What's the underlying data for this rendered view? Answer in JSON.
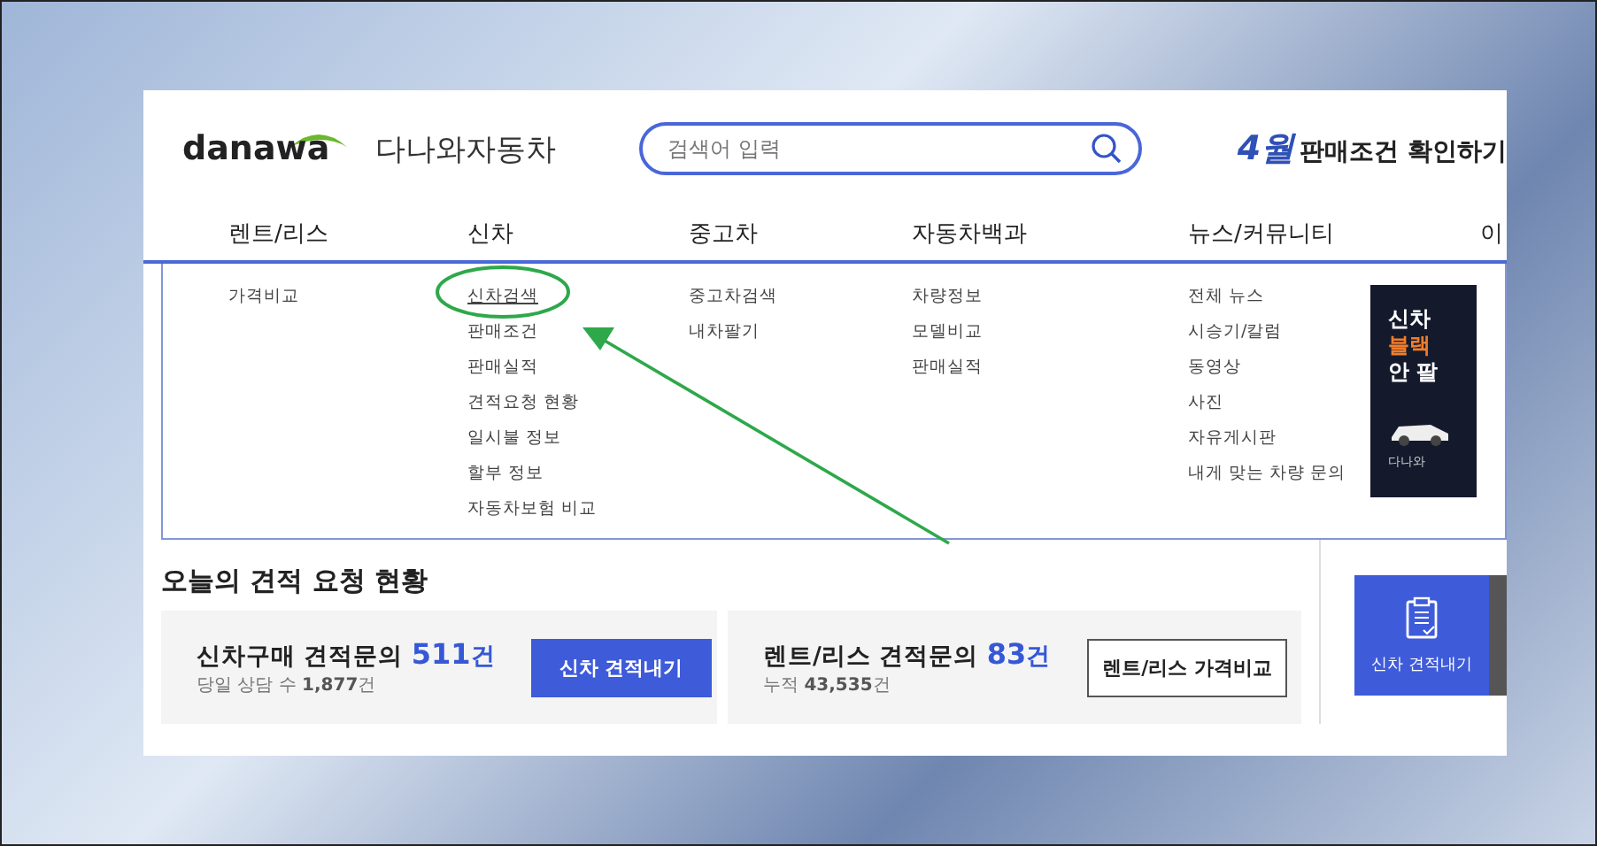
{
  "header": {
    "logo_text": "danawa",
    "brand": "다나와자동차",
    "search": {
      "placeholder": "검색어 입력"
    },
    "promo": {
      "month": "4월",
      "text": "판매조건 확인하기"
    }
  },
  "nav": [
    {
      "label": "렌트/리스",
      "items": [
        {
          "label": "가격비교",
          "selected": false
        }
      ]
    },
    {
      "label": "신차",
      "items": [
        {
          "label": "신차검색",
          "selected": true
        },
        {
          "label": "판매조건",
          "selected": false
        },
        {
          "label": "판매실적",
          "selected": false
        },
        {
          "label": "견적요청 현황",
          "selected": false
        },
        {
          "label": "일시불 정보",
          "selected": false
        },
        {
          "label": "할부 정보",
          "selected": false
        },
        {
          "label": "자동차보험 비교",
          "selected": false
        }
      ]
    },
    {
      "label": "중고차",
      "items": [
        {
          "label": "중고차검색",
          "selected": false
        },
        {
          "label": "내차팔기",
          "selected": false
        }
      ]
    },
    {
      "label": "자동차백과",
      "items": [
        {
          "label": "차량정보",
          "selected": false
        },
        {
          "label": "모델비교",
          "selected": false
        },
        {
          "label": "판매실적",
          "selected": false
        }
      ]
    },
    {
      "label": "뉴스/커뮤니티",
      "items": [
        {
          "label": "전체 뉴스",
          "selected": false
        },
        {
          "label": "시승기/칼럼",
          "selected": false
        },
        {
          "label": "동영상",
          "selected": false
        },
        {
          "label": "사진",
          "selected": false
        },
        {
          "label": "자유게시판",
          "selected": false
        },
        {
          "label": "내게 맞는 차량 문의",
          "selected": false
        }
      ]
    },
    {
      "label": "이"
    }
  ],
  "ad": {
    "lines": [
      "신차",
      "블랙",
      "안 팔"
    ],
    "caption": "다나와"
  },
  "quotes": {
    "title": "오늘의 견적 요청 현황",
    "cards": [
      {
        "label": "신차구매 견적문의",
        "count": "511",
        "unit": "건",
        "sub_label": "당일 상담 수",
        "sub_count": "1,877",
        "sub_unit": "건",
        "button": "신차 견적내기",
        "kind": "primary"
      },
      {
        "label": "렌트/리스 견적문의",
        "count": "83",
        "unit": "건",
        "sub_label": "누적",
        "sub_count": "43,535",
        "sub_unit": "건",
        "button": "렌트/리스 가격비교",
        "kind": "outline"
      }
    ]
  },
  "side_button": {
    "label": "신차 견적내기"
  }
}
